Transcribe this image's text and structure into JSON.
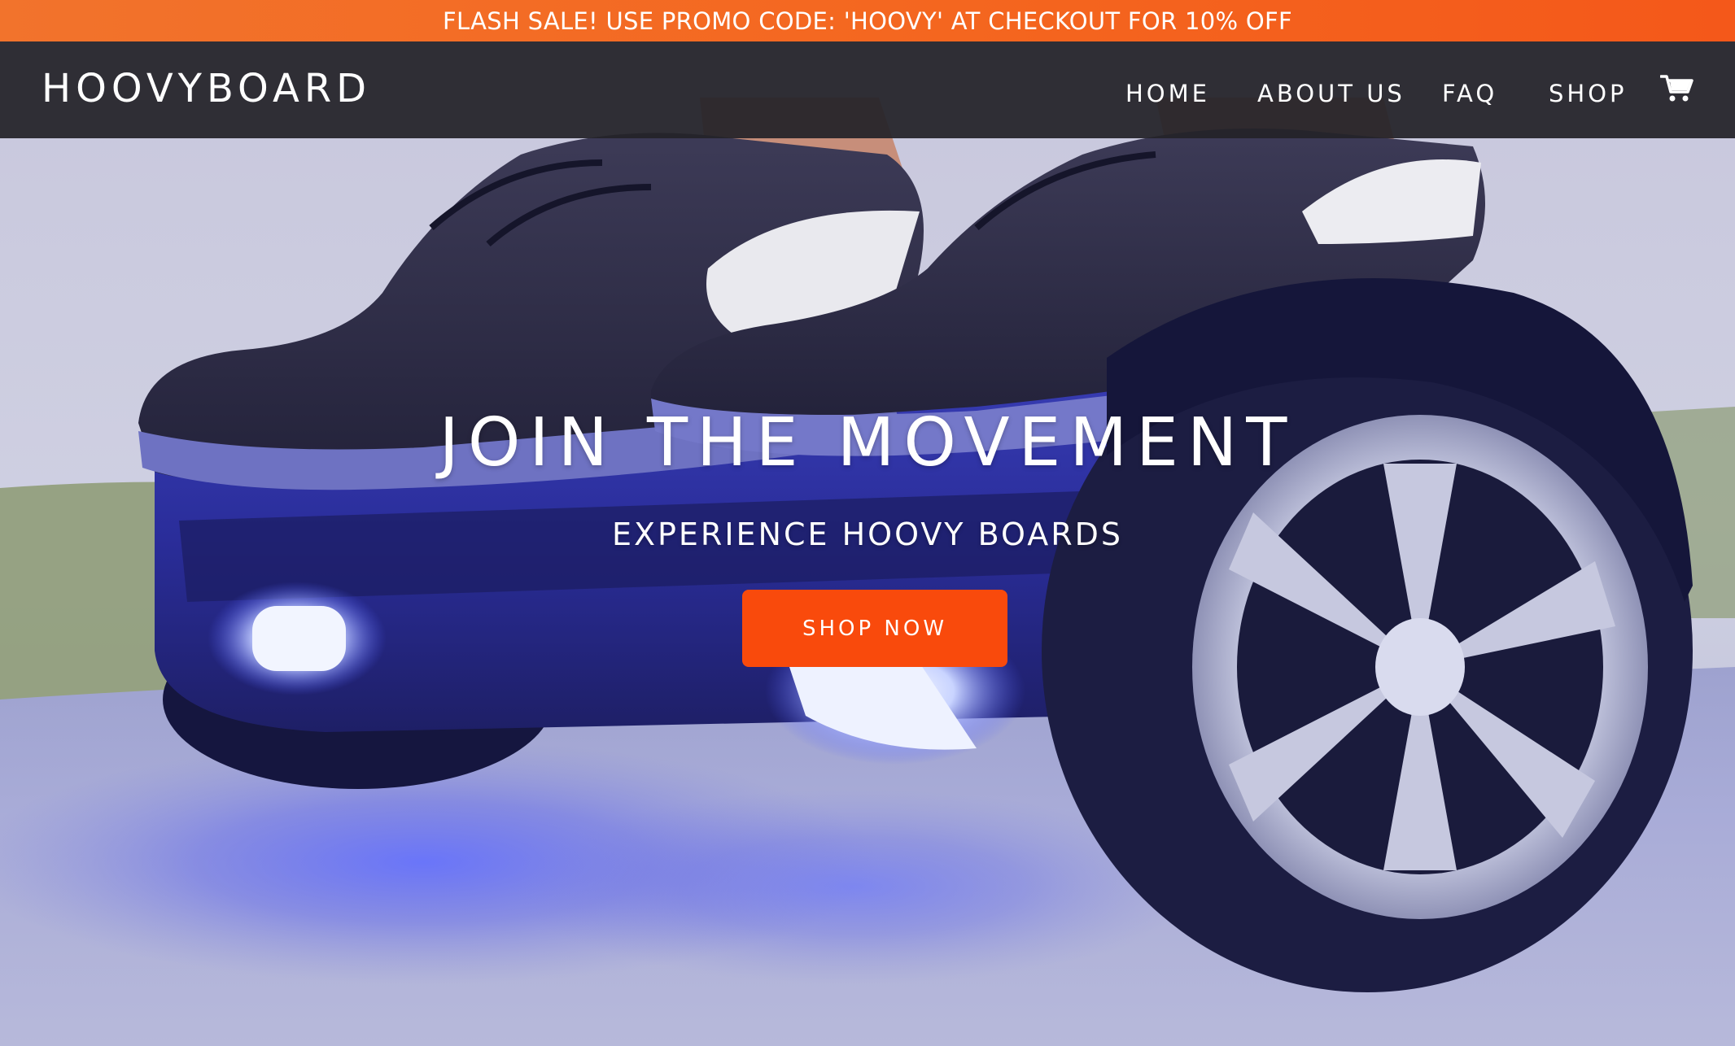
{
  "promo_banner": {
    "text": "FLASH SALE! USE PROMO CODE: 'HOOVY' AT CHECKOUT FOR 10% OFF",
    "color": "#f4661f"
  },
  "header": {
    "logo": "HOOVYBOARD",
    "nav": {
      "home": "HOME",
      "about": "ABOUT US",
      "faq": "FAQ",
      "shop": "SHOP"
    },
    "cart_icon": "shopping-cart-icon",
    "background": "#242228"
  },
  "hero": {
    "title": "JOIN THE MOVEMENT",
    "subtitle": "EXPERIENCE HOOVY BOARDS",
    "button_label": "SHOP NOW",
    "button_color": "#f94a0c",
    "background_image": "photo of feet in black sneakers riding a blue-lit hoverboard"
  }
}
